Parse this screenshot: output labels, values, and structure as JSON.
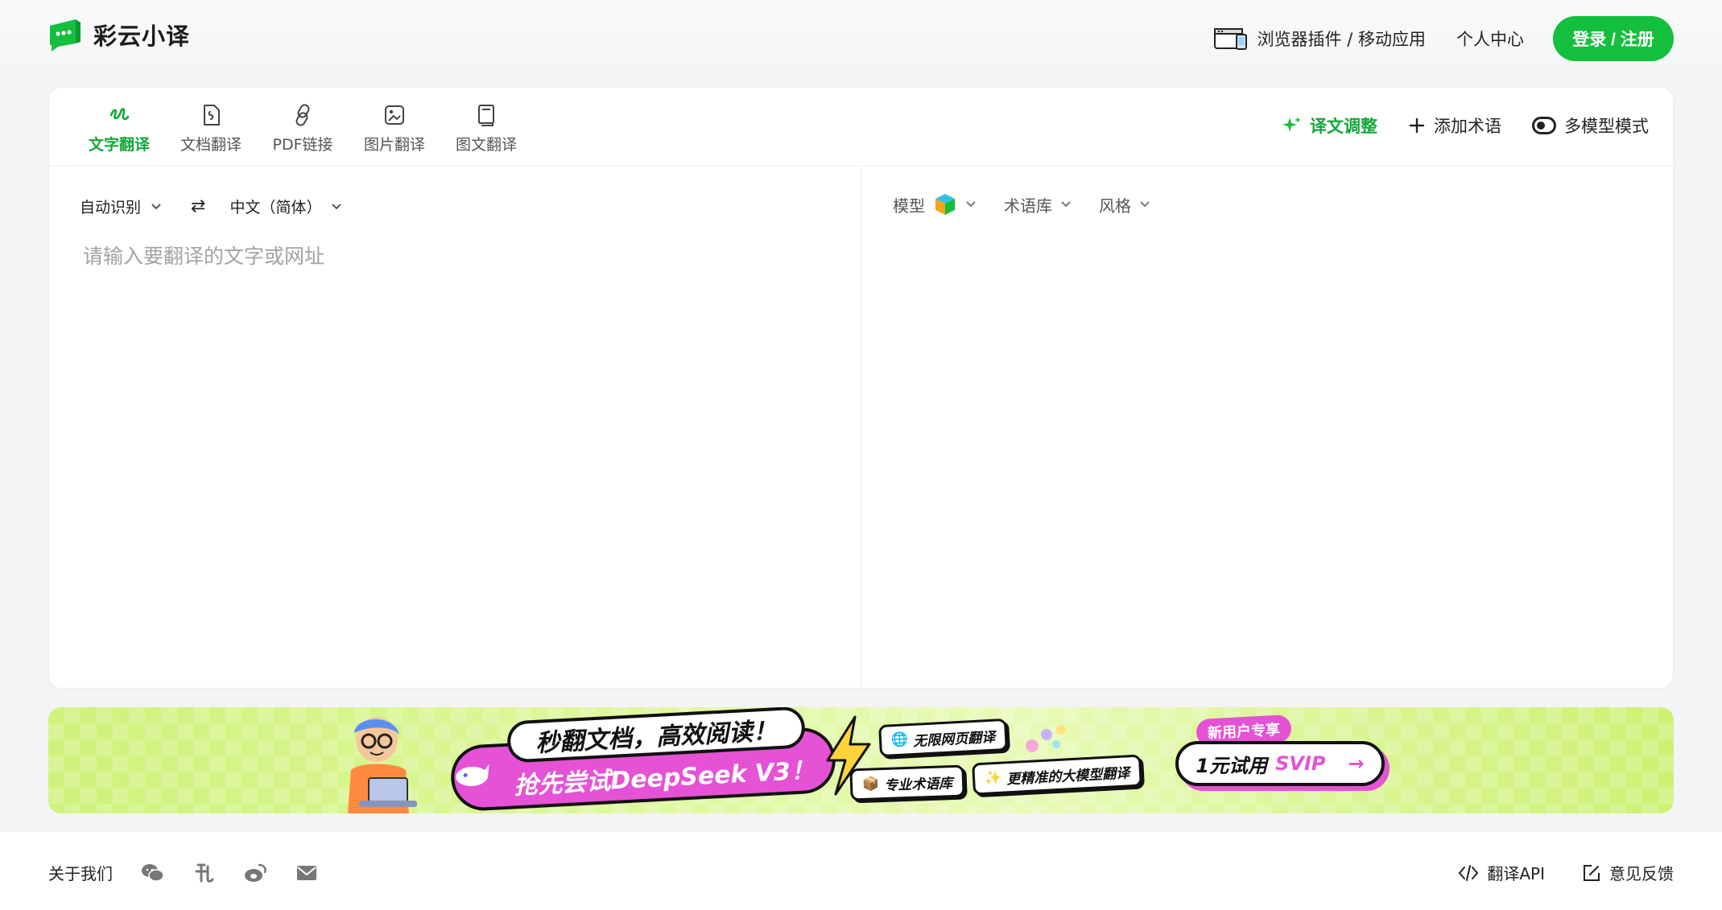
{
  "colors": {
    "brand_green": "#13bf3d",
    "active_tab": "#11a838",
    "banner_pink": "#e552d6"
  },
  "header": {
    "logo_text": "彩云小译",
    "logo_icon": "chat-bubble-logo-icon",
    "plugin_label": "浏览器插件 / 移动应用",
    "user_center": "个人中心",
    "login_label": "登录 / 注册"
  },
  "toolbar": {
    "tabs": [
      {
        "label": "文字翻译",
        "icon": "pen-scribble-icon",
        "active": true
      },
      {
        "label": "文档翻译",
        "icon": "document-icon",
        "active": false
      },
      {
        "label": "PDF链接",
        "icon": "link-icon",
        "active": false
      },
      {
        "label": "图片翻译",
        "icon": "image-icon",
        "active": false
      },
      {
        "label": "图文翻译",
        "icon": "book-icon",
        "active": false
      }
    ],
    "adjust_label": "译文调整",
    "add_term_label": "添加术语",
    "multi_model_label": "多模型模式"
  },
  "source": {
    "from_lang": "自动识别",
    "to_lang": "中文（简体）",
    "placeholder": "请输入要翻译的文字或网址",
    "value": ""
  },
  "target": {
    "model_label": "模型",
    "termbase_label": "术语库",
    "style_label": "风格"
  },
  "banner": {
    "headline": "秒翻文档，高效阅读！",
    "subline": "抢先尝试DeepSeek V3！",
    "chips": [
      "无限网页翻译",
      "专业术语库",
      "更精准的大模型翻译"
    ],
    "new_user_tag": "新用户专享",
    "cta_prefix": "1元试用",
    "cta_highlight": "SVIP",
    "cta_arrow": "→"
  },
  "footer": {
    "about": "关于我们",
    "icons": [
      "wechat-icon",
      "douyin-icon",
      "weibo-icon",
      "mail-icon"
    ],
    "api_label": "翻译API",
    "feedback_label": "意见反馈"
  }
}
